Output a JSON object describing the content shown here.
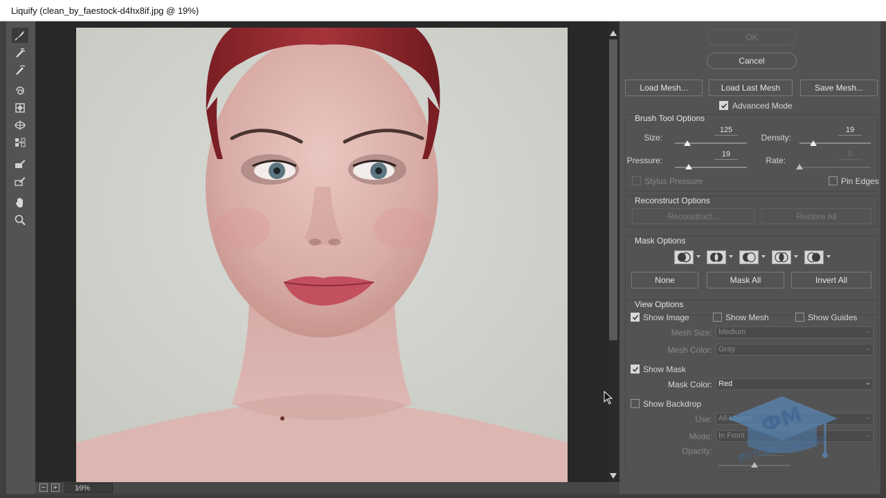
{
  "window": {
    "title": "Liquify (clean_by_faestock-d4hx8if.jpg @ 19%)"
  },
  "tools": [
    {
      "name": "forward-warp-tool-icon",
      "active": true
    },
    {
      "name": "reconstruct-tool-icon"
    },
    {
      "name": "smooth-tool-icon"
    },
    {
      "name": "twirl-clockwise-tool-icon"
    },
    {
      "name": "pucker-tool-icon"
    },
    {
      "name": "bloat-tool-icon"
    },
    {
      "name": "push-left-tool-icon"
    },
    {
      "name": "freeze-mask-tool-icon"
    },
    {
      "name": "thaw-mask-tool-icon"
    },
    {
      "name": "hand-tool-icon"
    },
    {
      "name": "zoom-tool-icon"
    }
  ],
  "status": {
    "zoom": "19%"
  },
  "actions": {
    "ok": "OK",
    "cancel": "Cancel",
    "load_mesh": "Load Mesh...",
    "load_last_mesh": "Load Last Mesh",
    "save_mesh": "Save Mesh...",
    "advanced_mode": "Advanced Mode"
  },
  "brush": {
    "title": "Brush Tool Options",
    "size_label": "Size:",
    "size": "125",
    "density_label": "Density:",
    "density": "19",
    "pressure_label": "Pressure:",
    "pressure": "19",
    "rate_label": "Rate:",
    "rate": "0",
    "stylus_pressure": "Stylus Pressure",
    "pin_edges": "Pin Edges"
  },
  "reconstruct": {
    "title": "Reconstruct Options",
    "reconstruct_btn": "Reconstruct...",
    "restore_all_btn": "Restore All"
  },
  "mask": {
    "title": "Mask Options",
    "icons": [
      "mask-replace-icon",
      "mask-add-icon",
      "mask-subtract-icon",
      "mask-intersect-icon",
      "mask-invert-icon"
    ],
    "none_btn": "None",
    "mask_all_btn": "Mask All",
    "invert_all_btn": "Invert All"
  },
  "view": {
    "title": "View Options",
    "show_image": "Show Image",
    "show_mesh": "Show Mesh",
    "show_guides": "Show Guides",
    "mesh_size_label": "Mesh Size:",
    "mesh_size": "Medium",
    "mesh_color_label": "Mesh Color:",
    "mesh_color": "Gray",
    "show_mask": "Show Mask",
    "mask_color_label": "Mask Color:",
    "mask_color": "Red",
    "show_backdrop": "Show Backdrop",
    "use_label": "Use:",
    "use": "All Layers",
    "mode_label": "Mode:",
    "mode": "In Front",
    "opacity_label": "Opacity:",
    "opacity": "50"
  },
  "sliders": {
    "size": 0.17,
    "density": 0.19,
    "pressure": 0.19,
    "rate": 0,
    "opacity": 0.5
  },
  "checkboxes": {
    "advanced_mode": true,
    "stylus_pressure": false,
    "pin_edges": false,
    "show_image": true,
    "show_mesh": false,
    "show_guides": false,
    "show_mask": true,
    "show_backdrop": false
  },
  "watermark": {
    "text": "ФОТОШОП МАСТЕР",
    "logo": "ФМ"
  }
}
